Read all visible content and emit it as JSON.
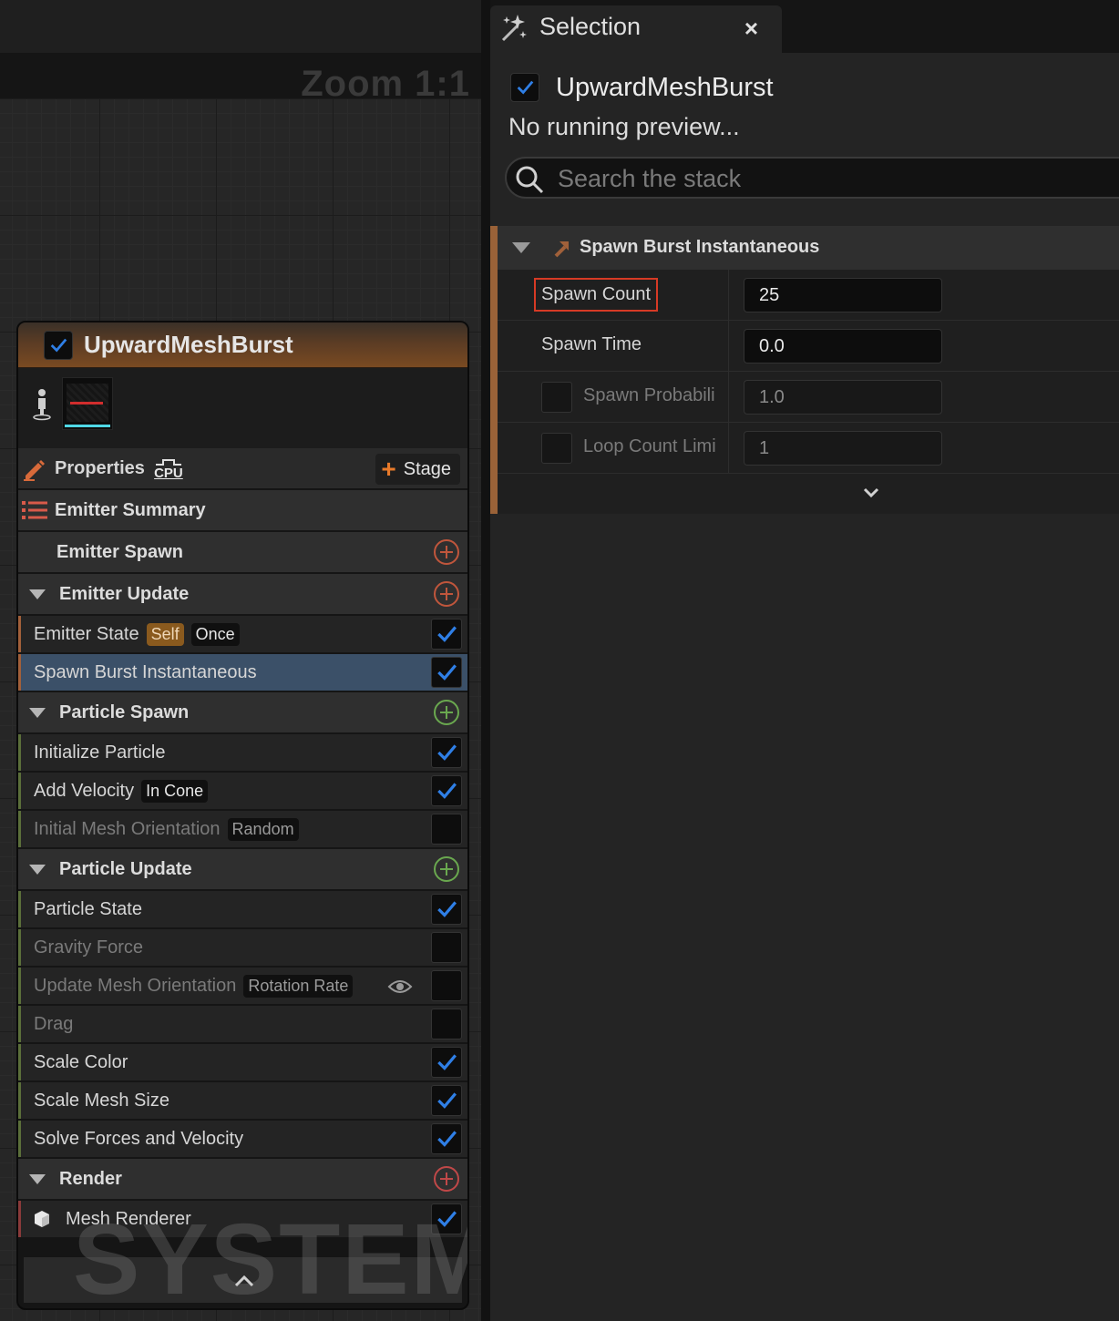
{
  "graph": {
    "zoom_label": "Zoom 1:1",
    "watermark": "SYSTEM",
    "node": {
      "title": "UpwardMeshBurst",
      "enabled": true,
      "properties_label": "Properties",
      "sim_target": "CPU",
      "stage_label": "Stage",
      "emitter_summary_label": "Emitter Summary",
      "sections": [
        {
          "label": "Emitter Spawn",
          "collapsible": false,
          "add_color": "#c0563c",
          "modules": []
        },
        {
          "label": "Emitter Update",
          "collapsible": true,
          "add_color": "#c0563c",
          "stripe_color": "#a2603a",
          "modules": [
            {
              "label": "Emitter State",
              "tags": [
                "Self",
                "Once"
              ],
              "enabled": true,
              "selected": false
            },
            {
              "label": "Spawn Burst Instantaneous",
              "tags": [],
              "enabled": true,
              "selected": true
            }
          ]
        },
        {
          "label": "Particle Spawn",
          "collapsible": true,
          "add_color": "#6aa84f",
          "stripe_color": "#5b6f3a",
          "modules": [
            {
              "label": "Initialize Particle",
              "tags": [],
              "enabled": true
            },
            {
              "label": "Add Velocity",
              "tags": [
                "In Cone"
              ],
              "enabled": true
            },
            {
              "label": "Initial Mesh Orientation",
              "tags": [
                "Random"
              ],
              "enabled": false
            }
          ]
        },
        {
          "label": "Particle Update",
          "collapsible": true,
          "add_color": "#6aa84f",
          "stripe_color": "#5b6f3a",
          "modules": [
            {
              "label": "Particle State",
              "tags": [],
              "enabled": true
            },
            {
              "label": "Gravity Force",
              "tags": [],
              "enabled": false
            },
            {
              "label": "Update Mesh Orientation",
              "tags": [
                "Rotation Rate"
              ],
              "enabled": false,
              "eye": true
            },
            {
              "label": "Drag",
              "tags": [],
              "enabled": false
            },
            {
              "label": "Scale Color",
              "tags": [],
              "enabled": true
            },
            {
              "label": "Scale Mesh Size",
              "tags": [],
              "enabled": true
            },
            {
              "label": "Solve Forces and Velocity",
              "tags": [],
              "enabled": true
            }
          ]
        },
        {
          "label": "Render",
          "collapsible": true,
          "add_color": "#c04848",
          "stripe_color": "#8a3a3a",
          "modules": [
            {
              "label": "Mesh Renderer",
              "tags": [],
              "enabled": true,
              "icon": "cube-icon"
            }
          ]
        }
      ]
    }
  },
  "panel": {
    "tab_title": "Selection",
    "tab_close": "×",
    "emitter_name": "UpwardMeshBurst",
    "emitter_enabled": true,
    "status": "No running preview...",
    "search_placeholder": "Search the stack",
    "module_title": "Spawn Burst Instantaneous",
    "params": [
      {
        "name": "Spawn Count",
        "value": "25",
        "highlighted": true,
        "has_toggle": false,
        "dim": false
      },
      {
        "name": "Spawn Time",
        "value": "0.0",
        "highlighted": false,
        "has_toggle": false,
        "dim": false
      },
      {
        "name": "Spawn Probabili",
        "value": "1.0",
        "highlighted": false,
        "has_toggle": true,
        "dim": true
      },
      {
        "name": "Loop Count Limi",
        "value": "1",
        "highlighted": false,
        "has_toggle": true,
        "dim": true
      }
    ]
  },
  "colors": {
    "accent_blue": "#2f7fe6",
    "emitter_orange": "#9a6238",
    "highlight_red": "#d63a25",
    "selected_row": "#3b5068"
  }
}
